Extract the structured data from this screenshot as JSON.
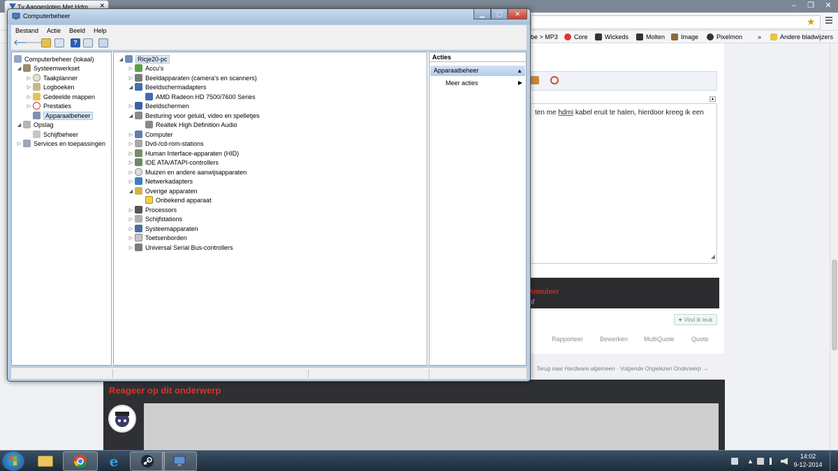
{
  "browser": {
    "tab_title": "Tv Aangesloten Met Hdm",
    "bookmarks": [
      "be > MP3",
      "Core",
      "Wickeds",
      "Molten",
      "Image",
      "Pixelmon"
    ],
    "bookmarks_more": "»",
    "other_bookmarks": "Andere bladwijzers",
    "editor_text_a": "ten me ",
    "editor_text_u": "hdmi",
    "editor_text_b": " kabel eruit te halen, hierdoor kreeg ik een",
    "cancel_prefix": "of ",
    "cancel_label": "Annuleer",
    "like_label": "Vind ik leuk",
    "post_actions": [
      "Rapporteer",
      "Bewerken",
      "MultiQuote",
      "Quote"
    ],
    "nav_links": "Terug naar Hardware algemeen · Volgende Ongelezen Onderwerp →",
    "reply_title": "Reageer op dit onderwerp"
  },
  "mmc": {
    "title": "Computerbeheer",
    "menu": [
      "Bestand",
      "Actie",
      "Beeld",
      "Help"
    ],
    "left_tree": [
      {
        "label": "Computerbeheer (lokaal)"
      },
      {
        "label": "Systeemwerkset"
      },
      {
        "label": "Taakplanner"
      },
      {
        "label": "Logboeken"
      },
      {
        "label": "Gedeelde mappen"
      },
      {
        "label": "Prestaties"
      },
      {
        "label": "Apparaatbeheer"
      },
      {
        "label": "Opslag"
      },
      {
        "label": "Schijfbeheer"
      },
      {
        "label": "Services en toepassingen"
      }
    ],
    "device_tree": [
      {
        "label": "Ricje20-pc"
      },
      {
        "label": "Accu's"
      },
      {
        "label": "Beeldapparaten (camera's en scanners)"
      },
      {
        "label": "Beeldschermadapters"
      },
      {
        "label": "AMD Radeon HD 7500/7600 Series"
      },
      {
        "label": "Beeldschermen"
      },
      {
        "label": "Besturing voor geluid, video en spelletjes"
      },
      {
        "label": "Realtek High Definition Audio"
      },
      {
        "label": "Computer"
      },
      {
        "label": "Dvd-/cd-rom-stations"
      },
      {
        "label": "Human Interface-apparaten (HID)"
      },
      {
        "label": "IDE ATA/ATAPI-controllers"
      },
      {
        "label": "Muizen en andere aanwijsapparaten"
      },
      {
        "label": "Netwerkadapters"
      },
      {
        "label": "Overige apparaten"
      },
      {
        "label": "Onbekend apparaat"
      },
      {
        "label": "Processors"
      },
      {
        "label": "Schijfstations"
      },
      {
        "label": "Systeemapparaten"
      },
      {
        "label": "Toetsenborden"
      },
      {
        "label": "Universal Serial Bus-controllers"
      }
    ],
    "actions": {
      "header": "Acties",
      "section": "Apparaatbeheer",
      "more": "Meer acties"
    }
  },
  "taskbar": {
    "time": "14:02",
    "date": "9-12-2014"
  },
  "colors": {
    "accent_red": "#e0281f",
    "selection": "#dbe7f6"
  }
}
